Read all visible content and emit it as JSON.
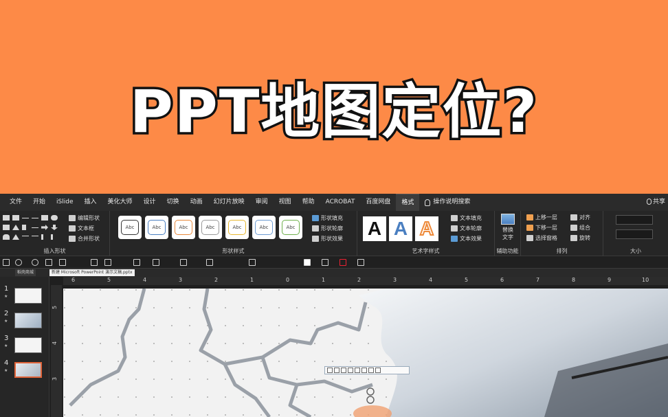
{
  "banner": {
    "title": "PPT地图定位?"
  },
  "menu": {
    "tabs": [
      "文件",
      "开始",
      "iSlide",
      "插入",
      "美化大师",
      "设计",
      "切换",
      "动画",
      "幻灯片放映",
      "审阅",
      "视图",
      "帮助",
      "ACROBAT",
      "百度网盘",
      "格式",
      "操作说明搜索"
    ],
    "active_tab": "格式",
    "share_label": "共享"
  },
  "ribbon": {
    "insert_shapes": {
      "label": "插入形状",
      "edit_shape": "编辑形状",
      "text_box": "文本框",
      "merge_shapes": "合并形状"
    },
    "shape_styles": {
      "label": "形状样式",
      "preset_text": "Abc",
      "fill": "形状填充",
      "outline": "形状轮廓",
      "effects": "形状效果"
    },
    "wordart": {
      "label": "艺术字样式",
      "preview_letter": "A",
      "text_fill": "文本填充",
      "text_outline": "文本轮廓",
      "text_effects": "文本效果"
    },
    "accessibility": {
      "label": "辅助功能",
      "alt_text_line1": "替换",
      "alt_text_line2": "文字"
    },
    "arrange": {
      "label": "排列",
      "bring_forward": "上移一层",
      "send_backward": "下移一层",
      "selection_pane": "选择窗格",
      "align": "对齐",
      "group": "组合",
      "rotate": "旋转"
    },
    "size": {
      "label": "大小"
    }
  },
  "doc_tabs": {
    "tab1": "稻壳商城",
    "tab2": "新建 Microsoft PowerPoint 演示文稿.pptx"
  },
  "slides": [
    {
      "number": "1",
      "star": "★"
    },
    {
      "number": "2",
      "star": "★"
    },
    {
      "number": "3",
      "star": "★"
    },
    {
      "number": "4",
      "star": "★"
    }
  ],
  "ruler": {
    "h": [
      "6",
      "5",
      "4",
      "3",
      "2",
      "1",
      "0",
      "1",
      "2",
      "3",
      "4",
      "5",
      "6",
      "7",
      "8",
      "9",
      "10"
    ],
    "v": [
      "5",
      "4",
      "3"
    ]
  },
  "colors": {
    "banner": "#fd8a47",
    "accent": "#e0643a"
  }
}
